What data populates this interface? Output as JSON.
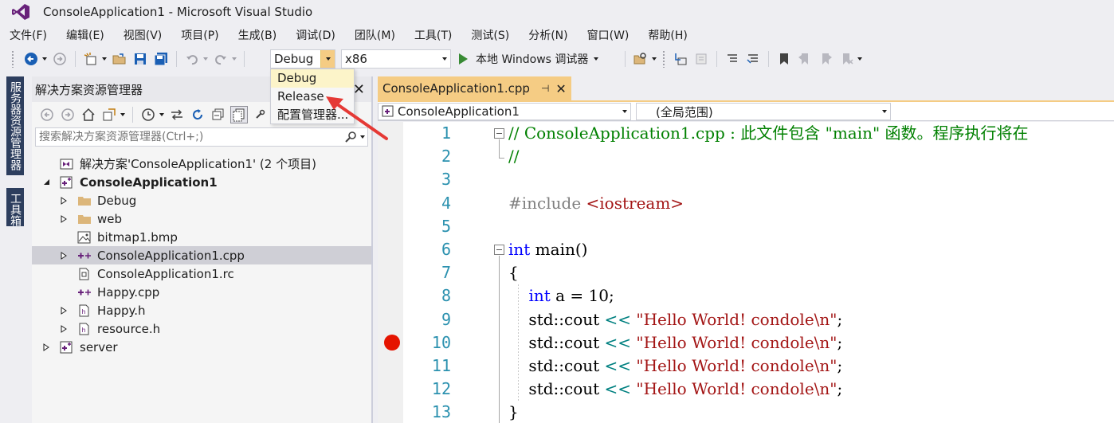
{
  "window": {
    "title": "ConsoleApplication1 - Microsoft Visual Studio"
  },
  "menu": [
    "文件(F)",
    "编辑(E)",
    "视图(V)",
    "项目(P)",
    "生成(B)",
    "调试(D)",
    "团队(M)",
    "工具(T)",
    "测试(S)",
    "分析(N)",
    "窗口(W)",
    "帮助(H)"
  ],
  "toolbar": {
    "config_value": "Debug",
    "platform_value": "x86",
    "run_label": "本地 Windows 调试器"
  },
  "config_dropdown": {
    "options": [
      "Debug",
      "Release",
      "配置管理器..."
    ],
    "selected_index": 0
  },
  "left_strip": {
    "tab1": "服务器资源管理器",
    "tab2": "工具箱"
  },
  "solution_explorer": {
    "title": "解决方案资源管理器",
    "search_placeholder": "搜索解决方案资源管理器(Ctrl+;)",
    "tree": [
      {
        "label": "解决方案'ConsoleApplication1' (2 个项目)",
        "icon": "solution-icon",
        "level": 0,
        "expander": "none",
        "bold": false,
        "selected": false
      },
      {
        "label": "ConsoleApplication1",
        "icon": "cpp-project-icon",
        "level": 0,
        "expander": "expanded",
        "bold": true,
        "selected": false
      },
      {
        "label": "Debug",
        "icon": "folder-icon",
        "level": 1,
        "expander": "collapsed",
        "bold": false,
        "selected": false
      },
      {
        "label": "web",
        "icon": "folder-icon",
        "level": 1,
        "expander": "collapsed",
        "bold": false,
        "selected": false
      },
      {
        "label": "bitmap1.bmp",
        "icon": "image-file-icon",
        "level": 1,
        "expander": "none",
        "bold": false,
        "selected": false
      },
      {
        "label": "ConsoleApplication1.cpp",
        "icon": "cpp-file-icon",
        "level": 1,
        "expander": "collapsed",
        "bold": false,
        "selected": true
      },
      {
        "label": "ConsoleApplication1.rc",
        "icon": "resource-file-icon",
        "level": 1,
        "expander": "none",
        "bold": false,
        "selected": false
      },
      {
        "label": "Happy.cpp",
        "icon": "cpp-file-icon",
        "level": 1,
        "expander": "none",
        "bold": false,
        "selected": false
      },
      {
        "label": "Happy.h",
        "icon": "header-file-icon",
        "level": 1,
        "expander": "collapsed",
        "bold": false,
        "selected": false
      },
      {
        "label": "resource.h",
        "icon": "header-file-icon",
        "level": 1,
        "expander": "collapsed",
        "bold": false,
        "selected": false
      },
      {
        "label": "server",
        "icon": "cpp-project-icon",
        "level": 0,
        "expander": "collapsed",
        "bold": false,
        "selected": false
      }
    ]
  },
  "editor": {
    "tab_label": "ConsoleApplication1.cpp",
    "pin_glyph": "⊣",
    "close_glyph": "✕",
    "nav_project": "ConsoleApplication1",
    "nav_scope": "(全局范围)",
    "breakpoint_line": 10,
    "line_numbers": [
      "1",
      "2",
      "3",
      "4",
      "5",
      "6",
      "7",
      "8",
      "9",
      "10",
      "11",
      "12",
      "13"
    ],
    "lines": [
      [
        {
          "t": "// ConsoleApplication1.cpp : 此文件包含 \"main\" 函数。程序执行将在",
          "c": "c-comment"
        }
      ],
      [
        {
          "t": "//",
          "c": "c-comment"
        }
      ],
      [],
      [
        {
          "t": "#include ",
          "c": "c-pre"
        },
        {
          "t": "<iostream>",
          "c": "c-inc"
        }
      ],
      [],
      [
        {
          "t": "int",
          "c": "c-kw"
        },
        {
          "t": " main()",
          "c": ""
        }
      ],
      [
        {
          "t": "{",
          "c": ""
        }
      ],
      [
        {
          "t": "    ",
          "c": ""
        },
        {
          "t": "int",
          "c": "c-kw"
        },
        {
          "t": " a = 10;",
          "c": ""
        }
      ],
      [
        {
          "t": "    std::cout ",
          "c": ""
        },
        {
          "t": "<<",
          "c": "c-op"
        },
        {
          "t": " ",
          "c": ""
        },
        {
          "t": "\"Hello World! condole\\n\"",
          "c": "c-str"
        },
        {
          "t": ";",
          "c": ""
        }
      ],
      [
        {
          "t": "    std::cout ",
          "c": ""
        },
        {
          "t": "<<",
          "c": "c-op"
        },
        {
          "t": " ",
          "c": ""
        },
        {
          "t": "\"Hello World! condole\\n\"",
          "c": "c-str"
        },
        {
          "t": ";",
          "c": ""
        }
      ],
      [
        {
          "t": "    std::cout ",
          "c": ""
        },
        {
          "t": "<<",
          "c": "c-op"
        },
        {
          "t": " ",
          "c": ""
        },
        {
          "t": "\"Hello World! condole\\n\"",
          "c": "c-str"
        },
        {
          "t": ";",
          "c": ""
        }
      ],
      [
        {
          "t": "    std::cout ",
          "c": ""
        },
        {
          "t": "<<",
          "c": "c-op"
        },
        {
          "t": " ",
          "c": ""
        },
        {
          "t": "\"Hello World! condole\\n\"",
          "c": "c-str"
        },
        {
          "t": ";",
          "c": ""
        }
      ],
      [
        {
          "t": "}",
          "c": ""
        }
      ]
    ]
  },
  "colors": {
    "accent_tab": "#f5cc84",
    "breakpoint": "#e51400",
    "annotation_arrow": "#e53935",
    "vtab_bg": "#2d3e5e"
  }
}
